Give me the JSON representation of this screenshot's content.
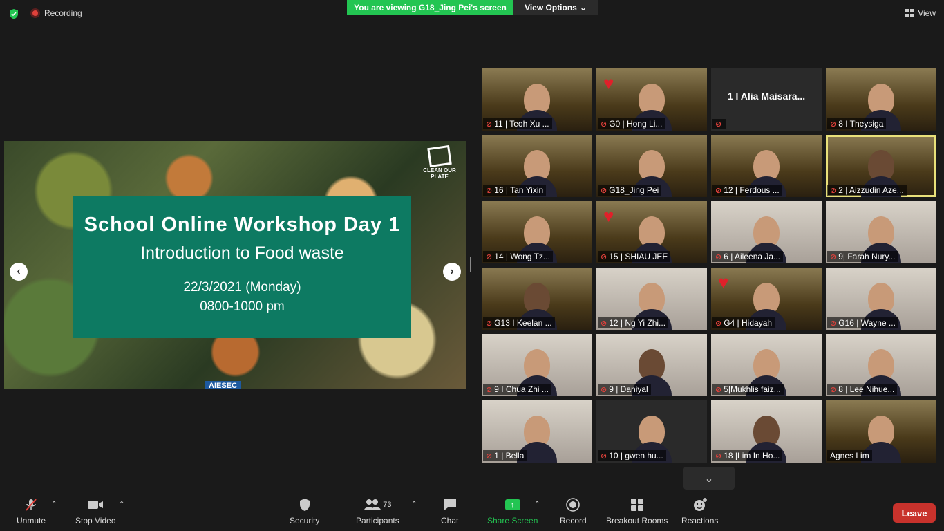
{
  "top": {
    "recording_label": "Recording",
    "viewing_banner": "You are viewing G18_Jing Pei's screen",
    "view_options_label": "View Options",
    "view_label": "View"
  },
  "slide": {
    "title": "School Online Workshop Day 1",
    "subtitle": "Introduction to Food waste",
    "date": "22/3/2021 (Monday)",
    "time": "0800-1000 pm",
    "logo_text": "CLEAN OUR PLATE",
    "footer_text": "AIESEC"
  },
  "participants": [
    {
      "name": "11 | Teoh Xu ...",
      "muted": true,
      "style": "room"
    },
    {
      "name": "G0 | Hong Li...",
      "muted": true,
      "style": "room",
      "heart": true
    },
    {
      "name": "",
      "muted": true,
      "style": "dark",
      "name_only": "1 I Alia Maisara..."
    },
    {
      "name": "8 I Theysiga",
      "muted": true,
      "style": "room"
    },
    {
      "name": "16 | Tan Yixin",
      "muted": true,
      "style": "room"
    },
    {
      "name": "G18_Jing Pei",
      "muted": true,
      "style": "room"
    },
    {
      "name": "12 | Ferdous ...",
      "muted": true,
      "style": "room"
    },
    {
      "name": "2 | Aizzudin Aze...",
      "muted": true,
      "style": "room",
      "active": true
    },
    {
      "name": "14 | Wong Tz...",
      "muted": true,
      "style": "room"
    },
    {
      "name": "15 | SHIAU JEE",
      "muted": true,
      "style": "room",
      "heart": true
    },
    {
      "name": "6 | Aileena Ja...",
      "muted": true,
      "style": "light"
    },
    {
      "name": "9| Farah Nury...",
      "muted": true,
      "style": "light"
    },
    {
      "name": "G13 I Keelan ...",
      "muted": true,
      "style": "room"
    },
    {
      "name": "12 | Ng Yi Zhi...",
      "muted": true,
      "style": "light"
    },
    {
      "name": "G4 | Hidayah",
      "muted": true,
      "style": "room",
      "heart": true
    },
    {
      "name": "G16 | Wayne ...",
      "muted": true,
      "style": "light"
    },
    {
      "name": "9 I Chua Zhi ...",
      "muted": true,
      "style": "light"
    },
    {
      "name": "9 | Daniyal",
      "muted": true,
      "style": "light"
    },
    {
      "name": "5|Mukhlis faiz...",
      "muted": true,
      "style": "light"
    },
    {
      "name": "8 | Lee Nihue...",
      "muted": true,
      "style": "light"
    },
    {
      "name": "1 | Bella",
      "muted": true,
      "style": "light"
    },
    {
      "name": "10 | gwen hu...",
      "muted": true,
      "style": "dark"
    },
    {
      "name": "18 |Lim In Ho...",
      "muted": true,
      "style": "light"
    },
    {
      "name": "Agnes Lim",
      "muted": false,
      "style": "room"
    }
  ],
  "toolbar": {
    "unmute": "Unmute",
    "stop_video": "Stop Video",
    "security": "Security",
    "participants": "Participants",
    "participants_count": "73",
    "chat": "Chat",
    "share_screen": "Share Screen",
    "record": "Record",
    "breakout_rooms": "Breakout Rooms",
    "reactions": "Reactions",
    "leave": "Leave"
  },
  "colors": {
    "accent_green": "#23c552",
    "leave_red": "#c8322c",
    "slide_card": "#0d7a62",
    "active_speaker": "#e8e07a"
  }
}
